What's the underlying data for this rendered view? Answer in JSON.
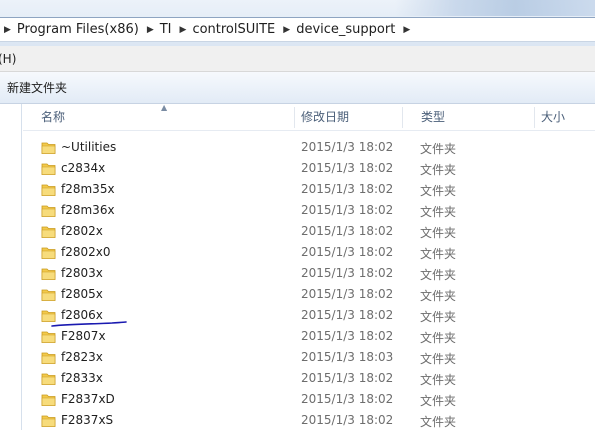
{
  "breadcrumb": {
    "items": [
      "Program Files(x86)",
      "TI",
      "controlSUITE",
      "device_support"
    ]
  },
  "menu": {
    "help_label": "(H)"
  },
  "toolbar": {
    "new_folder_label": "新建文件夹"
  },
  "columns": {
    "name": "名称",
    "date": "修改日期",
    "type": "类型",
    "size": "大小"
  },
  "files": [
    {
      "name": "~Utilities",
      "date": "2015/1/3 18:02",
      "type": "文件夹"
    },
    {
      "name": "c2834x",
      "date": "2015/1/3 18:02",
      "type": "文件夹"
    },
    {
      "name": "f28m35x",
      "date": "2015/1/3 18:02",
      "type": "文件夹"
    },
    {
      "name": "f28m36x",
      "date": "2015/1/3 18:02",
      "type": "文件夹"
    },
    {
      "name": "f2802x",
      "date": "2015/1/3 18:02",
      "type": "文件夹"
    },
    {
      "name": "f2802x0",
      "date": "2015/1/3 18:02",
      "type": "文件夹"
    },
    {
      "name": "f2803x",
      "date": "2015/1/3 18:02",
      "type": "文件夹"
    },
    {
      "name": "f2805x",
      "date": "2015/1/3 18:02",
      "type": "文件夹"
    },
    {
      "name": "f2806x",
      "date": "2015/1/3 18:02",
      "type": "文件夹"
    },
    {
      "name": "F2807x",
      "date": "2015/1/3 18:02",
      "type": "文件夹"
    },
    {
      "name": "f2823x",
      "date": "2015/1/3 18:03",
      "type": "文件夹"
    },
    {
      "name": "f2833x",
      "date": "2015/1/3 18:02",
      "type": "文件夹"
    },
    {
      "name": "F2837xD",
      "date": "2015/1/3 18:02",
      "type": "文件夹"
    },
    {
      "name": "F2837xS",
      "date": "2015/1/3 18:02",
      "type": "文件夹"
    }
  ],
  "colors": {
    "folder_yellow": "#f2c94c",
    "annotation_ink": "#1a1ab0",
    "header_text": "#4c607a"
  },
  "icons": {
    "folder": "folder-icon",
    "crumb_separator": "chevron-right-icon"
  }
}
